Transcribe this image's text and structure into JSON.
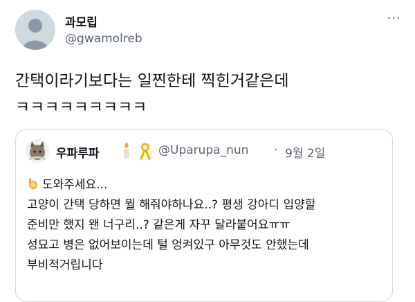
{
  "tweet": {
    "display_name": "과모립",
    "handle": "@gwamolreb",
    "more_label": "···",
    "text": "간택이라기보다는 일찐한테 찍힌거같은데\nㅋㅋㅋㅋㅋㅋㅋㅋㅋ"
  },
  "quote": {
    "display_name": "우파루파",
    "handle": "@Uparupa_nun",
    "separator": "·",
    "date": "9월 2일",
    "lines": [
      "도와주세요...",
      "고양이 간택 당하면 뭘 해줘야하나요..? 평생 강아디 입양할",
      "준비만 했지 왠 너구리..? 같은게 자꾸 달라붙어요ㅠㅠ",
      "성묘고 병은 없어보이는데 털 엉켜있구 아무것도 안했는데",
      "부비적거립니다"
    ]
  },
  "icons": {
    "avatar": "default-avatar-icon",
    "quote_avatar": "cat-avatar-icon",
    "candle": "candle-emoji-icon",
    "ribbon": "yellow-ribbon-icon",
    "raising_hand": "raising-hand-emoji-icon"
  },
  "colors": {
    "text": "#0f1419",
    "secondary": "#536471",
    "border": "#cfd9de",
    "ribbon": "#f2b705"
  }
}
